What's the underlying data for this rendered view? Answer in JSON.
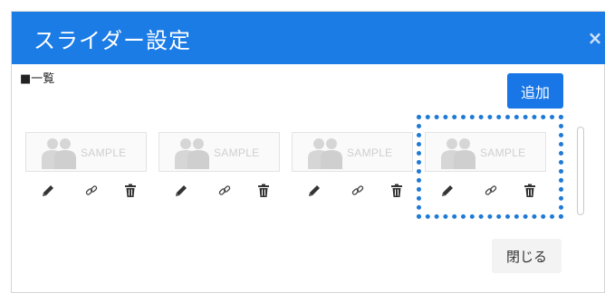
{
  "modal": {
    "title": "スライダー設定",
    "close_glyph": "×",
    "section_label": "■一覧",
    "add_label": "追加",
    "close_label": "閉じる"
  },
  "slides": [
    {
      "thumb_text": "SAMPLE"
    },
    {
      "thumb_text": "SAMPLE"
    },
    {
      "thumb_text": "SAMPLE"
    },
    {
      "thumb_text": "SAMPLE"
    }
  ],
  "icons": [
    "pencil-icon",
    "link-icon",
    "trash-icon"
  ],
  "colors": {
    "header": "#1c7ce6",
    "add_button": "#1876e6",
    "highlight": "#1f7ad6",
    "icon": "#333333"
  }
}
